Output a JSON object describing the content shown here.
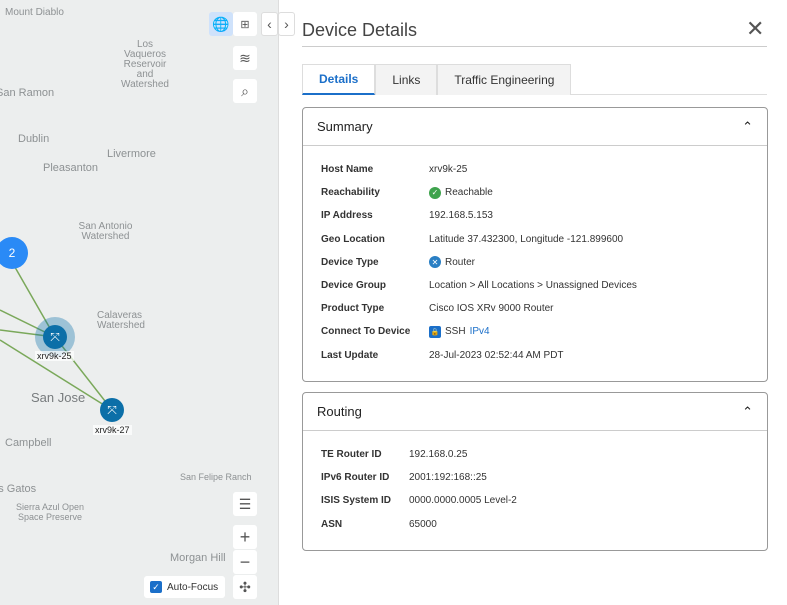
{
  "map": {
    "place_labels": [
      "Mount Diablo",
      "Los Vaqueros Reservoir and Watershed",
      "San Ramon",
      "Dublin",
      "Livermore",
      "Pleasanton",
      "San Antonio Watershed",
      "Calaveras Watershed",
      "San Jose",
      "Campbell",
      "San Felipe Ranch",
      "Los Gatos",
      "Sierra Azul Open Space Preserve",
      "Morgan Hill"
    ],
    "cluster_count": "2",
    "nodes": [
      {
        "label": "xrv9k-25"
      },
      {
        "label": "xrv9k-27"
      }
    ],
    "auto_focus": {
      "label": "Auto-Focus",
      "checked": true
    },
    "colors": {
      "link": "#7aa85a",
      "node": "#0c6fa8",
      "cluster": "#2a8af6"
    }
  },
  "panel": {
    "title": "Device Details",
    "tabs": [
      {
        "label": "Details"
      },
      {
        "label": "Links"
      },
      {
        "label": "Traffic Engineering"
      }
    ],
    "summary": {
      "title": "Summary",
      "rows": [
        {
          "k": "Host Name",
          "v": "xrv9k-25"
        },
        {
          "k": "Reachability",
          "v": "Reachable"
        },
        {
          "k": "IP Address",
          "v": "192.168.5.153"
        },
        {
          "k": "Geo Location",
          "v": "Latitude 37.432300, Longitude -121.899600"
        },
        {
          "k": "Device Type",
          "v": "Router"
        },
        {
          "k": "Device Group",
          "v": "Location > All Locations > Unassigned Devices"
        },
        {
          "k": "Product Type",
          "v": "Cisco IOS XRv 9000 Router"
        },
        {
          "k": "Connect To Device",
          "v": "SSH",
          "link": "IPv4"
        },
        {
          "k": "Last Update",
          "v": "28-Jul-2023 02:52:44 AM PDT"
        }
      ]
    },
    "routing": {
      "title": "Routing",
      "rows": [
        {
          "k": "TE Router ID",
          "v": "192.168.0.25"
        },
        {
          "k": "IPv6 Router ID",
          "v": "2001:192:168::25"
        },
        {
          "k": "ISIS System ID",
          "v": "0000.0000.0005 Level-2"
        },
        {
          "k": "ASN",
          "v": "65000"
        }
      ]
    }
  }
}
